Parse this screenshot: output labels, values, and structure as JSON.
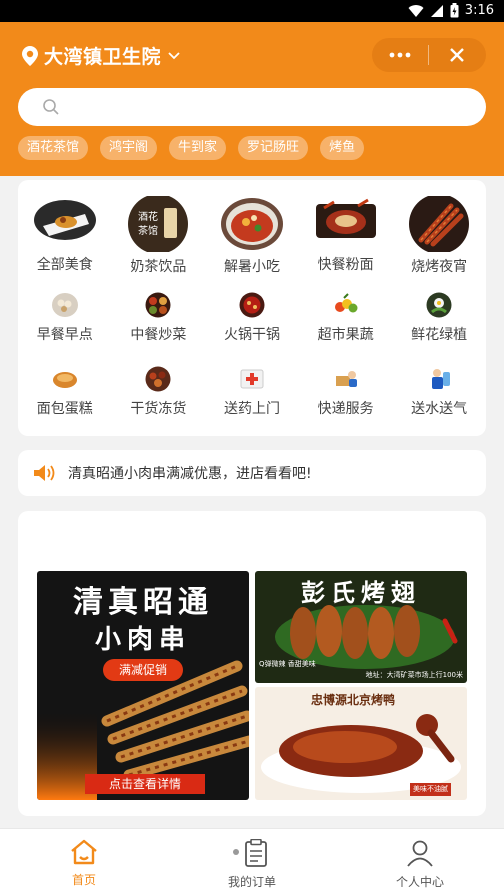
{
  "status_bar": {
    "time": "3:16"
  },
  "header": {
    "location": "大湾镇卫生院",
    "search_placeholder": "",
    "tags": [
      "酒花茶馆",
      "鸿宇阁",
      "牛到家",
      "罗记肠旺",
      "烤鱼"
    ]
  },
  "categories": {
    "row1": [
      "全部美食",
      "奶茶饮品",
      "解暑小吃",
      "快餐粉面",
      "烧烤夜宵"
    ],
    "row2": [
      "早餐早点",
      "中餐炒菜",
      "火锅干锅",
      "超市果蔬",
      "鲜花绿植"
    ],
    "row3": [
      "面包蛋糕",
      "干货冻货",
      "送药上门",
      "快递服务",
      "送水送气"
    ],
    "milk_tea_logo_text": "酒花茶馆"
  },
  "notice": {
    "text": "清真昭通小肉串满减优惠，进店看看吧!"
  },
  "promo": {
    "left": {
      "title": "清真昭通",
      "subtitle": "小肉串",
      "badge": "满减促销",
      "button": "点击查看详情"
    },
    "top_right": {
      "title": "彭氏烤翅",
      "caption_left": "Q弹微辣 香甜美味",
      "caption_right": "地址：大湾矿菜市场上行100米"
    },
    "bottom_right": {
      "title": "忠博源北京烤鸭",
      "caption": "美味不油腻"
    }
  },
  "tabbar": {
    "items": [
      "首页",
      "我的订单",
      "个人中心"
    ],
    "active": 0
  },
  "colors": {
    "primary": "#f28a1a",
    "tag_bg": "#f7b26a",
    "capsule": "#e57e14"
  }
}
